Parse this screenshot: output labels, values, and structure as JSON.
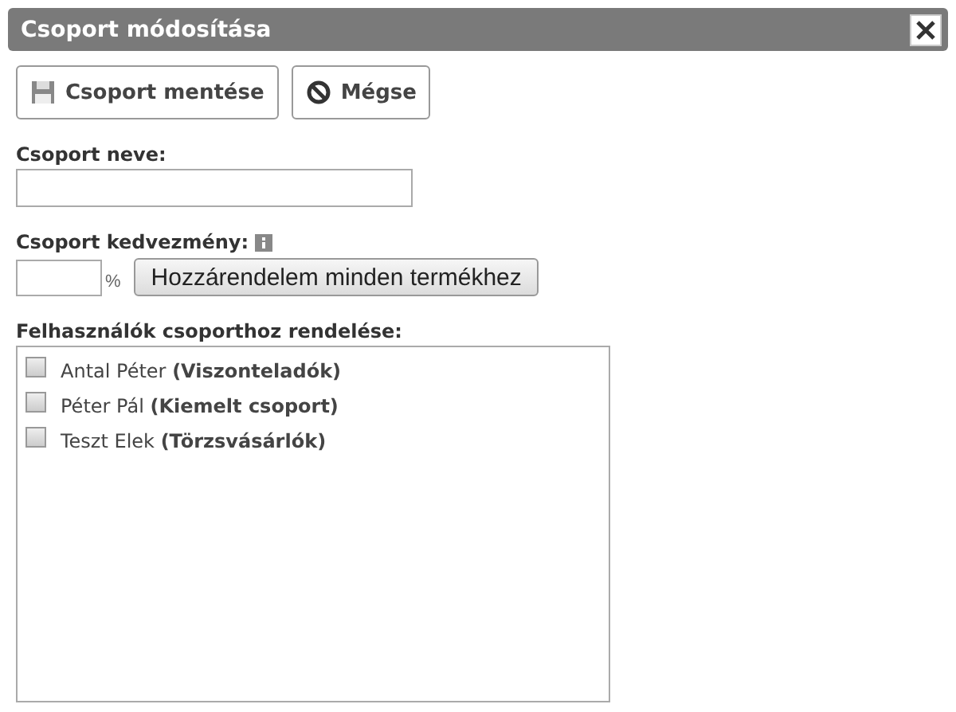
{
  "window": {
    "title": "Csoport módosítása"
  },
  "toolbar": [
    {
      "kind": "save",
      "label": "Csoport mentése"
    },
    {
      "kind": "cancel",
      "label": "Mégse"
    }
  ],
  "name_field": {
    "label": "Csoport neve:"
  },
  "discount": {
    "label": "Csoport kedvezmény:",
    "unit": "%",
    "button": "Hozzárendelem minden termékhez"
  },
  "users": {
    "label": "Felhasználók csoporthoz rendelése:",
    "items": [
      {
        "text": "Antal Péter **(Viszonteladók)**",
        "checked": false
      },
      {
        "text": "Péter Pál **(Kiemelt csoport)**",
        "checked": false
      },
      {
        "text": "Teszt Elek **(Törzsvásárlók)**",
        "checked": false
      }
    ]
  }
}
